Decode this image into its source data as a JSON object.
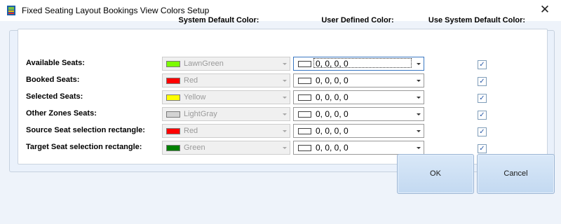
{
  "window": {
    "title": "Fixed Seating Layout Bookings View Colors Setup",
    "close_glyph": "✕"
  },
  "headers": {
    "system_default": "System Default Color:",
    "user_defined": "User Defined Color:",
    "use_system_default": "Use System Default Color:"
  },
  "rows": [
    {
      "label": "Available Seats:",
      "system_color_name": "LawnGreen",
      "system_swatch": "#7cfc00",
      "user_color": "0, 0, 0, 0",
      "use_system_default": true,
      "focused": true
    },
    {
      "label": "Booked Seats:",
      "system_color_name": "Red",
      "system_swatch": "#ff0000",
      "user_color": "0, 0, 0, 0",
      "use_system_default": true
    },
    {
      "label": "Selected Seats:",
      "system_color_name": "Yellow",
      "system_swatch": "#ffff00",
      "user_color": "0, 0, 0, 0",
      "use_system_default": true
    },
    {
      "label": "Other Zones Seats:",
      "system_color_name": "LightGray",
      "system_swatch": "#d3d3d3",
      "user_color": "0, 0, 0, 0",
      "use_system_default": true
    },
    {
      "label": "Source Seat selection rectangle:",
      "system_color_name": "Red",
      "system_swatch": "#ff0000",
      "user_color": "0, 0, 0, 0",
      "use_system_default": true
    },
    {
      "label": "Target Seat selection rectangle:",
      "system_color_name": "Green",
      "system_swatch": "#008000",
      "user_color": "0, 0, 0, 0",
      "use_system_default": true
    }
  ],
  "buttons": {
    "ok": "OK",
    "cancel": "Cancel"
  }
}
